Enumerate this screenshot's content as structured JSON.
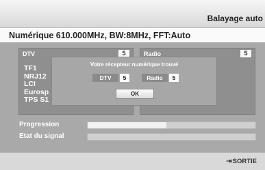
{
  "header": {
    "title": "Balayage auto"
  },
  "info": {
    "text": "Numérique 610.000MHz, BW:8MHz, FFT:Auto"
  },
  "panels": {
    "dtv": {
      "label": "DTV",
      "count": "5",
      "channels": [
        "TF1",
        "NRJ12",
        "LCI",
        "Eurosp",
        "TPS S1"
      ]
    },
    "radio": {
      "label": "Radio",
      "count": "5"
    }
  },
  "dialog": {
    "message": "Votre récepteur numérique trouvé",
    "dtv_label": "DTV",
    "dtv_count": "5",
    "radio_label": "Radio",
    "radio_count": "5",
    "ok_label": "OK"
  },
  "progress": {
    "label": "Progression",
    "fraction": 0.47
  },
  "signal": {
    "label": "Etat du signal",
    "fraction": 0.0
  },
  "footer": {
    "exit_label": "SORTIE",
    "exit_icon": "exit-icon"
  }
}
